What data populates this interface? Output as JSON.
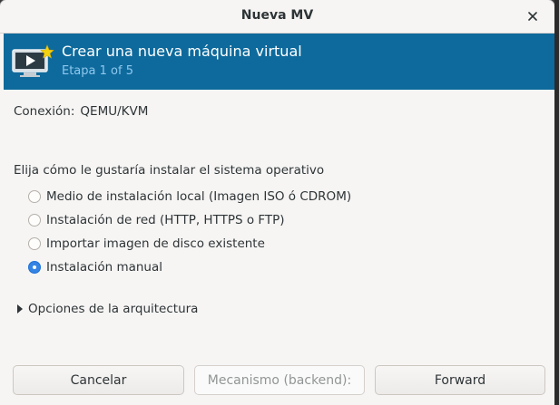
{
  "window": {
    "title": "Nueva MV"
  },
  "banner": {
    "title": "Crear una nueva máquina virtual",
    "step": "Etapa 1 of 5"
  },
  "connection": {
    "label": "Conexión:",
    "value": "QEMU/KVM"
  },
  "install": {
    "question": "Elija cómo le gustaría instalar el sistema operativo",
    "options": [
      {
        "label": "Medio de instalación local (Imagen ISO ó CDROM)",
        "selected": false
      },
      {
        "label": "Instalación de red (HTTP, HTTPS o FTP)",
        "selected": false
      },
      {
        "label": "Importar imagen de disco existente",
        "selected": false
      },
      {
        "label": "Instalación manual",
        "selected": true
      }
    ]
  },
  "architecture": {
    "label": "Opciones de la arquitectura",
    "expanded": false
  },
  "buttons": {
    "cancel": "Cancelar",
    "backend": "Mecanismo (backend):",
    "forward": "Forward"
  },
  "colors": {
    "banner_bg": "#0e6a9c",
    "accent": "#3584e4"
  },
  "icons": {
    "close": "close-icon",
    "banner": "monitor-play-icon",
    "expander": "triangle-right-icon"
  }
}
